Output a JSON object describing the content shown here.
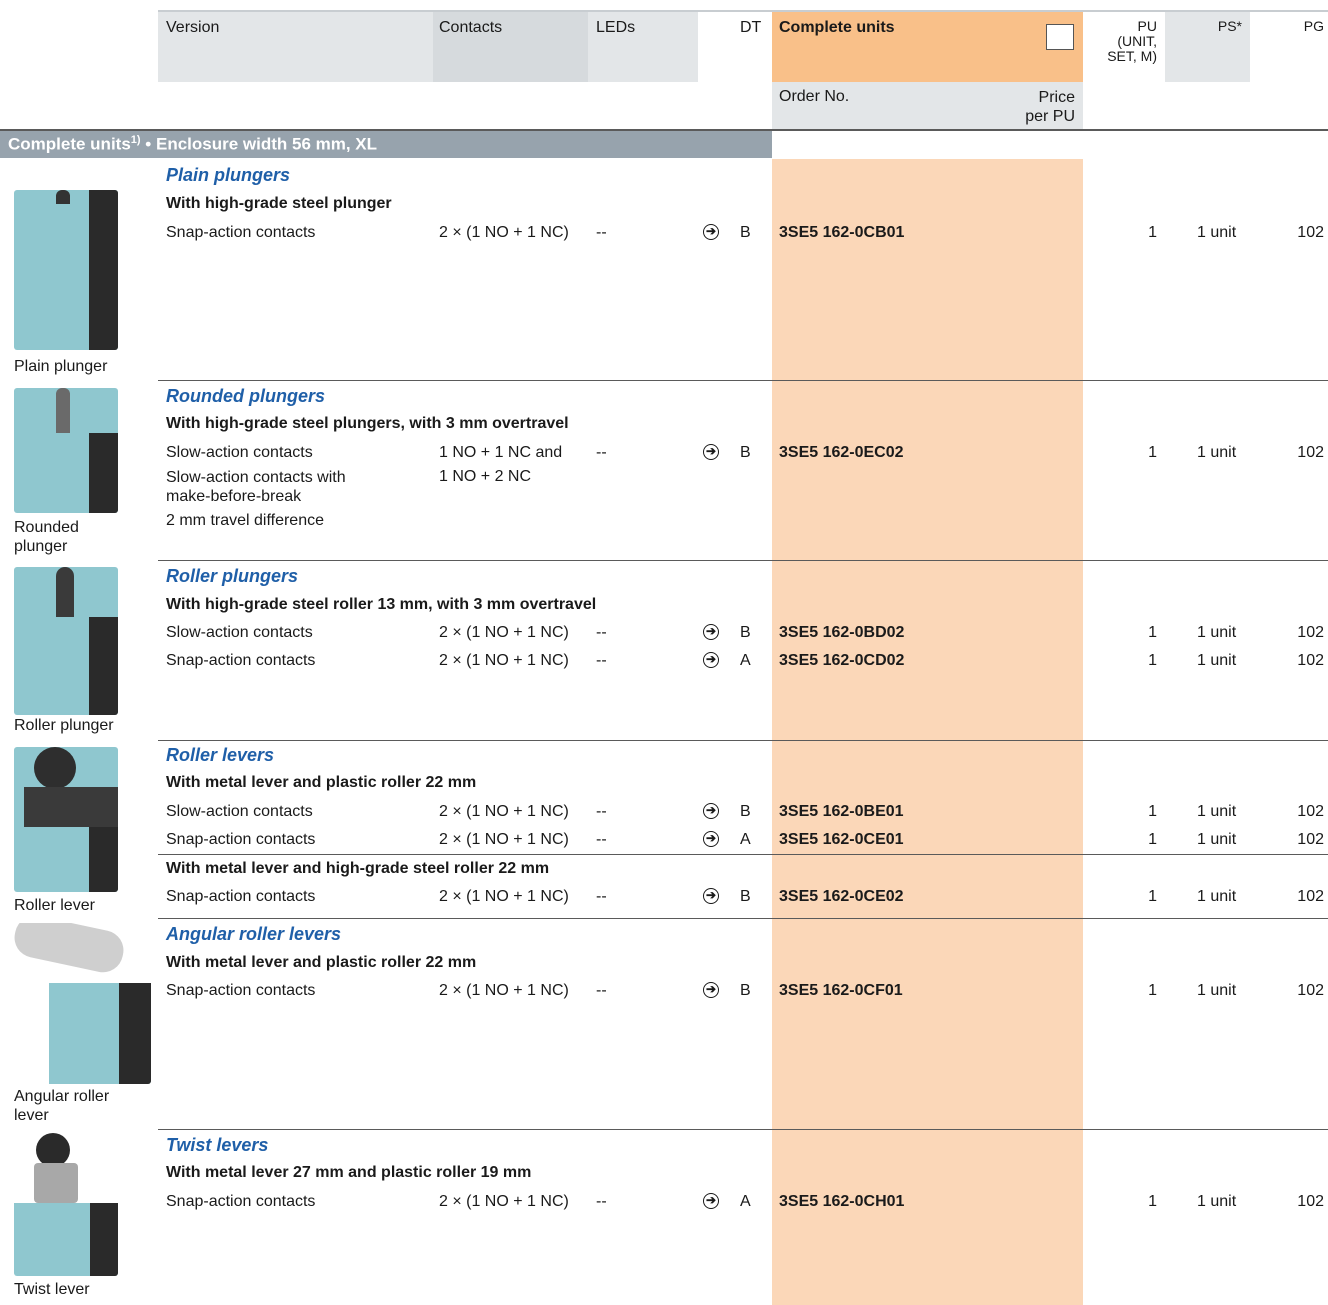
{
  "header": {
    "version": "Version",
    "contacts": "Contacts",
    "leds": "LEDs",
    "dt": "DT",
    "complete_units": "Complete units",
    "pu_line1": "PU",
    "pu_line2": "(UNIT,",
    "pu_line3": "SET, M)",
    "ps": "PS*",
    "pg": "PG",
    "order_no": "Order No.",
    "price_line1": "Price",
    "price_line2": "per PU"
  },
  "section_bar": {
    "title": "Complete units",
    "sup": "1)",
    "rest": " • Enclosure width 56 mm, XL"
  },
  "groups": [
    {
      "title": "Plain plungers",
      "image_caption_1": "Plain plunger",
      "subtitle": "With high-grade steel plunger",
      "rows": [
        {
          "version": "Snap-action contacts",
          "contacts": "2 × (1 NO + 1 NC)",
          "leds": "--",
          "dt": "B",
          "order": "3SE5 162-0CB01",
          "pu": "1",
          "ps": "1 unit",
          "pg": "102"
        }
      ]
    },
    {
      "title": "Rounded plungers",
      "image_caption_1": "Rounded",
      "image_caption_2": "plunger",
      "subtitle": "With high-grade steel plungers, with 3 mm overtravel",
      "rows": [
        {
          "version": "Slow-action contacts",
          "contacts": "1 NO + 1 NC and",
          "leds": "--",
          "dt": "B",
          "order": "3SE5 162-0EC02",
          "pu": "1",
          "ps": "1 unit",
          "pg": "102"
        }
      ],
      "extra_lines": [
        "Slow-action contacts with",
        "make-before-break",
        "2 mm travel difference"
      ],
      "extra_contacts": "1 NO + 2 NC"
    },
    {
      "title": "Roller plungers",
      "image_caption_1": "Roller plunger",
      "subtitle": "With high-grade steel roller 13 mm, with 3 mm overtravel",
      "rows": [
        {
          "version": "Slow-action contacts",
          "contacts": "2 × (1 NO + 1 NC)",
          "leds": "--",
          "dt": "B",
          "order": "3SE5 162-0BD02",
          "pu": "1",
          "ps": "1 unit",
          "pg": "102"
        },
        {
          "version": "Snap-action contacts",
          "contacts": "2 × (1 NO + 1 NC)",
          "leds": "--",
          "dt": "A",
          "order": "3SE5 162-0CD02",
          "pu": "1",
          "ps": "1 unit",
          "pg": "102"
        }
      ]
    },
    {
      "title": "Roller levers",
      "image_caption_1": "Roller lever",
      "subtitle": "With metal lever and plastic roller 22 mm",
      "rows": [
        {
          "version": "Slow-action contacts",
          "contacts": "2 × (1 NO + 1 NC)",
          "leds": "--",
          "dt": "B",
          "order": "3SE5 162-0BE01",
          "pu": "1",
          "ps": "1 unit",
          "pg": "102"
        },
        {
          "version": "Snap-action contacts",
          "contacts": "2 × (1 NO + 1 NC)",
          "leds": "--",
          "dt": "A",
          "order": "3SE5 162-0CE01",
          "pu": "1",
          "ps": "1 unit",
          "pg": "102"
        }
      ],
      "subtitle2": "With metal lever and high-grade steel roller 22 mm",
      "rows2": [
        {
          "version": "Snap-action contacts",
          "contacts": "2 × (1 NO + 1 NC)",
          "leds": "--",
          "dt": "B",
          "order": "3SE5 162-0CE02",
          "pu": "1",
          "ps": "1 unit",
          "pg": "102"
        }
      ]
    },
    {
      "title": "Angular roller levers",
      "image_caption_1": "Angular roller",
      "image_caption_2": "lever",
      "subtitle": "With metal lever and plastic roller 22 mm",
      "rows": [
        {
          "version": "Snap-action contacts",
          "contacts": "2 × (1 NO + 1 NC)",
          "leds": "--",
          "dt": "B",
          "order": "3SE5 162-0CF01",
          "pu": "1",
          "ps": "1 unit",
          "pg": "102"
        }
      ]
    },
    {
      "title": "Twist levers",
      "image_caption_1": "Twist lever",
      "subtitle": "With metal lever 27 mm and plastic roller 19 mm",
      "rows": [
        {
          "version": "Snap-action contacts",
          "contacts": "2 × (1 NO + 1 NC)",
          "leds": "--",
          "dt": "A",
          "order": "3SE5 162-0CH01",
          "pu": "1",
          "ps": "1 unit",
          "pg": "102"
        }
      ]
    }
  ],
  "colors": {
    "header_gray": "#e3e6e8",
    "orange_header": "#f9c089",
    "orange_column": "#fbd7b8",
    "section_bar": "#97a3ad",
    "blue_title": "#1f5fa8",
    "product_body": "#8fc7cf"
  },
  "icons": {
    "delivery_arrow": "circle-arrow-right-icon",
    "checkbox": "empty-checkbox-icon"
  }
}
